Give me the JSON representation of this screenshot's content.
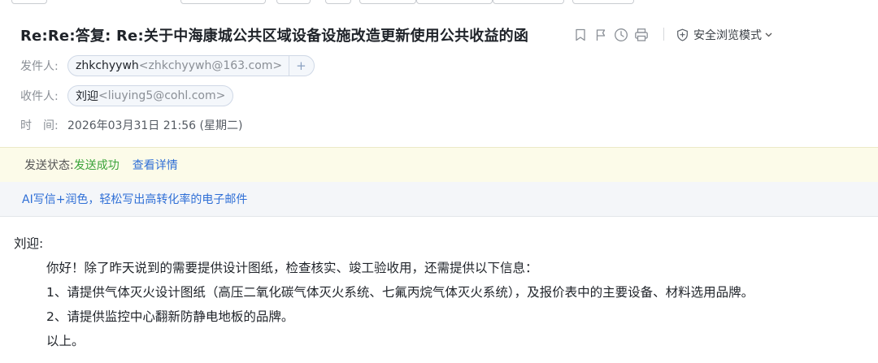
{
  "email": {
    "subject": "Re:Re:答复: Re:关于中海康城公共区域设备设施改造更新使用公共收益的函",
    "safe_mode_label": "安全浏览模式",
    "from": {
      "label": "发件人:",
      "name": "zhkchyywh",
      "email": "<zhkchyywh@163.com>"
    },
    "to": {
      "label": "收件人:",
      "name": "刘迎",
      "email": "<liuying5@cohl.com>"
    },
    "time": {
      "label": "时　间:",
      "value": "2026年03月31日 21:56 (星期二)"
    },
    "status": {
      "label": "发送状态:",
      "value": "发送成功",
      "details_link": "查看详情"
    },
    "ai_promo": "AI写信+润色，轻松写出高转化率的电子邮件",
    "body": {
      "greeting": "刘迎:",
      "lines": [
        "你好！除了昨天说到的需要提供设计图纸，检查核实、竣工验收用，还需提供以下信息：",
        "1、请提供气体灭火设计图纸（高压二氧化碳气体灭火系统、七氟丙烷气体灭火系统），及报价表中的主要设备、材料选用品牌。",
        "2、请提供监控中心翻新防静电地板的品牌。",
        "以上。"
      ]
    }
  },
  "icons": [
    "bookmark-icon",
    "flag-icon",
    "clock-icon",
    "print-icon",
    "shield-icon",
    "chevron-down-icon",
    "add-contact-icon"
  ],
  "colors": {
    "link": "#2f6fd6",
    "success": "#3aa33a",
    "status_bg": "#fcfbe9"
  }
}
